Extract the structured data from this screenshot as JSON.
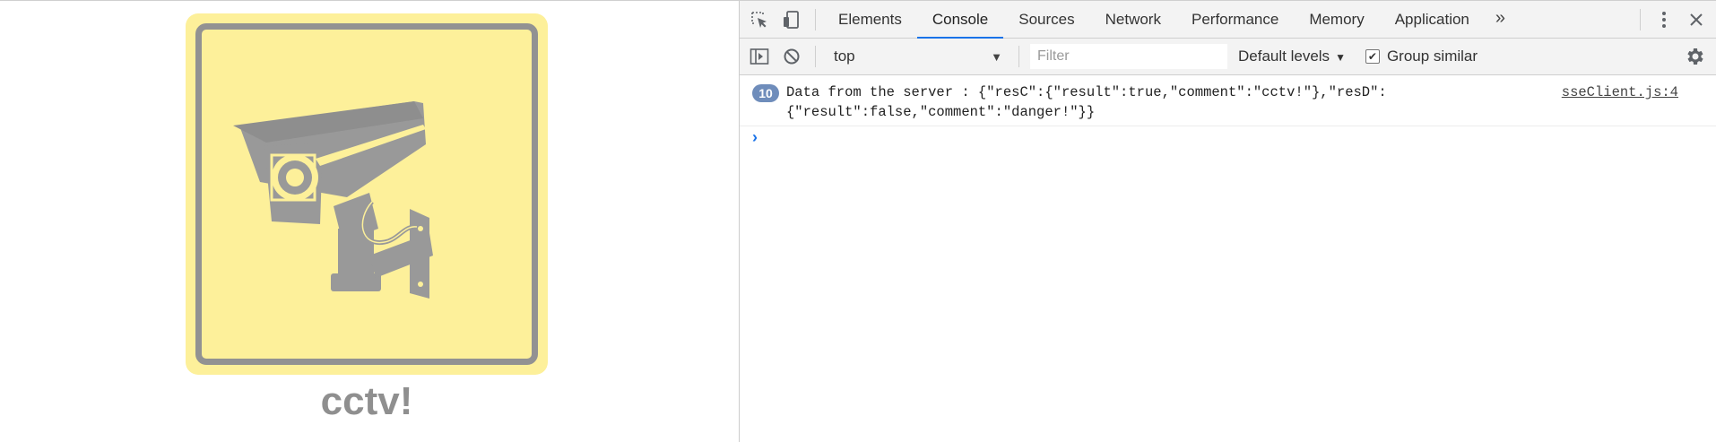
{
  "page": {
    "caption": "cctv!",
    "colors": {
      "sign_bg": "#fdf09a",
      "sign_border": "#929292",
      "camera": "#999999"
    }
  },
  "devtools": {
    "tabs": [
      "Elements",
      "Console",
      "Sources",
      "Network",
      "Performance",
      "Memory",
      "Application"
    ],
    "active_tab": "Console",
    "icons": [
      "inspect-element-icon",
      "device-toolbar-icon",
      "more-tabs-icon",
      "kebab-menu-icon",
      "close-icon"
    ],
    "toolbar": {
      "context": "top",
      "filter_placeholder": "Filter",
      "levels": "Default levels",
      "group_similar_label": "Group similar",
      "group_similar_checked": true
    },
    "console": {
      "messages": [
        {
          "count": "10",
          "text": "Data from the server : {\"resC\":{\"result\":true,\"comment\":\"cctv!\"},\"resD\":\n{\"result\":false,\"comment\":\"danger!\"}}",
          "source": "sseClient.js:4"
        }
      ]
    }
  }
}
